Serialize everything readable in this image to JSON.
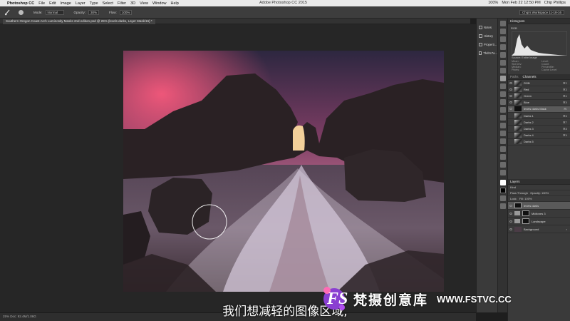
{
  "menubar": {
    "app": "Photoshop CC",
    "items": [
      "File",
      "Edit",
      "Image",
      "Layer",
      "Type",
      "Select",
      "Filter",
      "3D",
      "View",
      "Window",
      "Help"
    ],
    "window_title": "Adobe Photoshop CC 2015",
    "right": [
      "100%",
      "Mon Feb 22 12:50 PM",
      "Chip Phillips"
    ]
  },
  "options": {
    "mode_label": "Mode:",
    "mode_value": "Normal",
    "opacity_label": "Opacity:",
    "opacity_value": "30%",
    "flow_label": "Flow:",
    "flow_value": "100%",
    "workspace": "Chip's Workspace 11-18-16"
  },
  "document": {
    "tab_title": "Southern Oregon Coast Arch Luminosity Masks 2nd edition.psd @ 25% (levels darks, Layer Mask/16) *",
    "status": "25%     Doc: 92.4M/1.06G"
  },
  "icon_strip": {
    "items": [
      "Notes",
      "History",
      "Properti...",
      "Tbd2c7a..."
    ]
  },
  "histogram": {
    "tab": "Histogram",
    "channel": "RGB",
    "source_label": "Source:",
    "source_value": "Entire Image",
    "stats": [
      "Mean:",
      "Std Dev:",
      "Median:",
      "Pixels:",
      "Level:",
      "Count:",
      "Percentile:",
      "Cache Level:"
    ]
  },
  "channels": {
    "tabs": [
      "Paths",
      "Channels"
    ],
    "rows": [
      {
        "name": "RGB",
        "key": "⌘2"
      },
      {
        "name": "Red",
        "key": "⌘3"
      },
      {
        "name": "Green",
        "key": "⌘4"
      },
      {
        "name": "Blue",
        "key": "⌘5"
      },
      {
        "name": "levels darks Mask",
        "key": "⌘\\"
      },
      {
        "name": "Darks 1",
        "key": "⌘6"
      },
      {
        "name": "Darks 2",
        "key": "⌘7"
      },
      {
        "name": "Darks 3",
        "key": "⌘8"
      },
      {
        "name": "Darks 4",
        "key": "⌘9"
      },
      {
        "name": "Darks 5",
        "key": ""
      }
    ]
  },
  "layers": {
    "tab": "Layers",
    "kind_label": "Kind",
    "blend": "Pass Through",
    "opacity": "Opacity: 100%",
    "fill": "Fill: 100%",
    "lock": "Lock:",
    "rows": [
      {
        "name": "levels darks"
      },
      {
        "name": "Midtones 3"
      },
      {
        "name": "Landscape"
      },
      {
        "name": "Background"
      }
    ]
  },
  "subtitle": "我们想减轻的图像区域,",
  "watermark": {
    "logo": "FS",
    "text_cn": "梵摄创意库",
    "url": "WWW.FSTVC.CC"
  },
  "colors": {
    "sky_top": "#3b2a4a",
    "sky_glow": "#d85a7a",
    "rock": "#2a2225",
    "water": "#cfc6d8"
  }
}
